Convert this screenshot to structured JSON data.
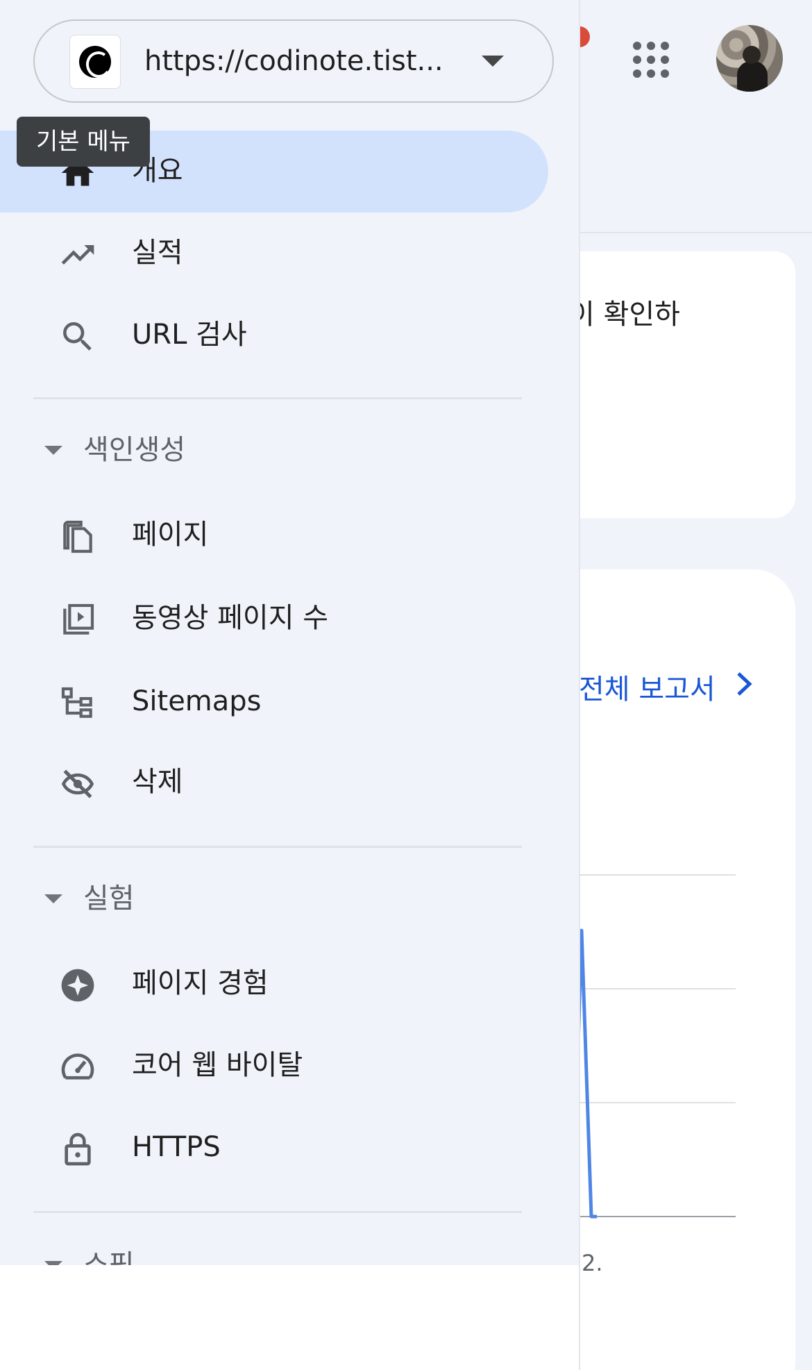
{
  "background": {
    "card1_text": "이 확인하",
    "full_report_label": "전체 보고서",
    "chart_x_label": "2.",
    "colors": {
      "accent": "#1a57d6",
      "chart_line": "#4f86e6",
      "notification": "#d84c3a"
    }
  },
  "header": {
    "apps_icon": "apps-grid-icon",
    "avatar_icon": "account-avatar"
  },
  "property_selector": {
    "url": "https://codinote.tist..."
  },
  "tooltip": {
    "text": "기본 메뉴"
  },
  "nav": {
    "primary": [
      {
        "label": "개요",
        "icon": "home-icon",
        "active": true
      },
      {
        "label": "실적",
        "icon": "trending-up-icon",
        "active": false
      },
      {
        "label": "URL 검사",
        "icon": "search-icon",
        "active": false
      }
    ],
    "sections": [
      {
        "label": "색인생성",
        "items": [
          {
            "label": "페이지",
            "icon": "pages-icon"
          },
          {
            "label": "동영상 페이지 수",
            "icon": "video-pages-icon"
          },
          {
            "label": "Sitemaps",
            "icon": "sitemap-icon"
          },
          {
            "label": "삭제",
            "icon": "visibility-off-icon"
          }
        ]
      },
      {
        "label": "실험",
        "items": [
          {
            "label": "페이지 경험",
            "icon": "page-experience-icon"
          },
          {
            "label": "코어 웹 바이탈",
            "icon": "speed-gauge-icon"
          },
          {
            "label": "HTTPS",
            "icon": "lock-icon"
          }
        ]
      },
      {
        "label": "쇼핑"
      }
    ]
  }
}
